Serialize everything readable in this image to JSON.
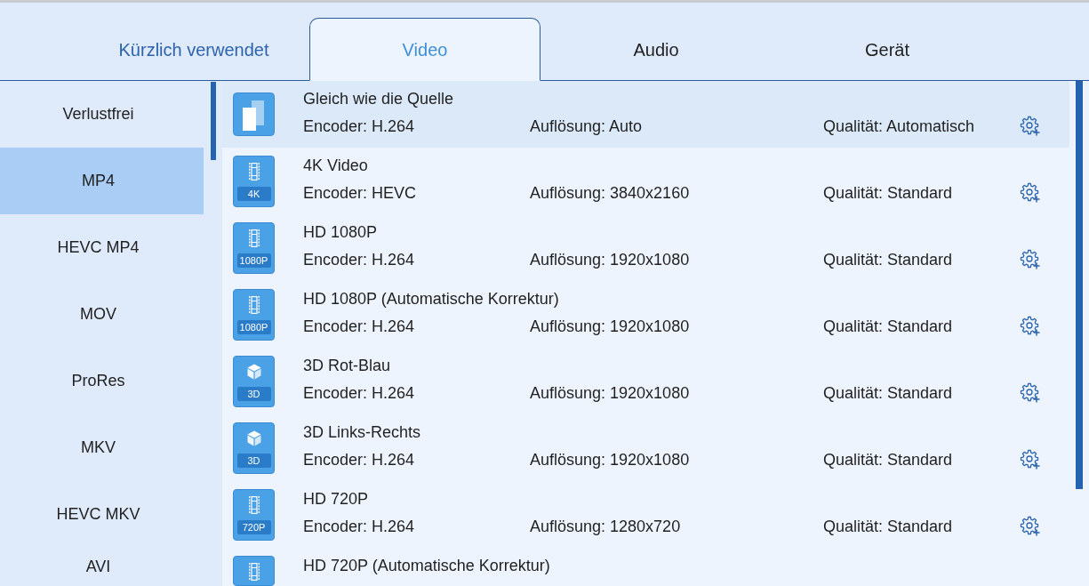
{
  "tabs": [
    {
      "label": "Kürzlich verwendet",
      "selected": false,
      "hovered": true
    },
    {
      "label": "Video",
      "selected": true,
      "hovered": false
    },
    {
      "label": "Audio",
      "selected": false,
      "hovered": false
    },
    {
      "label": "Gerät",
      "selected": false,
      "hovered": false
    }
  ],
  "sidebar": {
    "items": [
      {
        "label": "Verlustfrei",
        "selected": false
      },
      {
        "label": "MP4",
        "selected": true
      },
      {
        "label": "HEVC MP4",
        "selected": false
      },
      {
        "label": "MOV",
        "selected": false
      },
      {
        "label": "ProRes",
        "selected": false
      },
      {
        "label": "MKV",
        "selected": false
      },
      {
        "label": "HEVC MKV",
        "selected": false
      },
      {
        "label": "AVI",
        "selected": false
      }
    ]
  },
  "presets": [
    {
      "kind": "copy",
      "title": "Gleich wie die Quelle",
      "encoder": "Encoder: H.264",
      "resolution": "Auflösung: Auto",
      "quality": "Qualität: Automatisch",
      "selected": true
    },
    {
      "kind": "film",
      "badge": "4K",
      "title": "4K Video",
      "encoder": "Encoder: HEVC",
      "resolution": "Auflösung: 3840x2160",
      "quality": "Qualität: Standard",
      "selected": false
    },
    {
      "kind": "film",
      "badge": "1080P",
      "title": "HD 1080P",
      "encoder": "Encoder: H.264",
      "resolution": "Auflösung: 1920x1080",
      "quality": "Qualität: Standard",
      "selected": false
    },
    {
      "kind": "film",
      "badge": "1080P",
      "title": "HD 1080P (Automatische Korrektur)",
      "encoder": "Encoder: H.264",
      "resolution": "Auflösung: 1920x1080",
      "quality": "Qualität: Standard",
      "selected": false
    },
    {
      "kind": "cube",
      "badge": "3D",
      "title": "3D Rot-Blau",
      "encoder": "Encoder: H.264",
      "resolution": "Auflösung: 1920x1080",
      "quality": "Qualität: Standard",
      "selected": false
    },
    {
      "kind": "cube",
      "badge": "3D",
      "title": "3D Links-Rechts",
      "encoder": "Encoder: H.264",
      "resolution": "Auflösung: 1920x1080",
      "quality": "Qualität: Standard",
      "selected": false
    },
    {
      "kind": "film",
      "badge": "720P",
      "title": "HD 720P",
      "encoder": "Encoder: H.264",
      "resolution": "Auflösung: 1280x720",
      "quality": "Qualität: Standard",
      "selected": false
    },
    {
      "kind": "film",
      "title": "HD 720P (Automatische Korrektur)",
      "selected": false
    }
  ]
}
